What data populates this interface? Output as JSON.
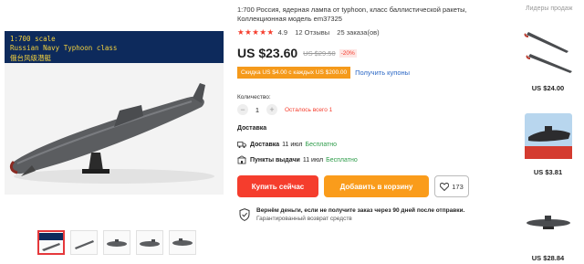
{
  "gallery": {
    "banner_lines": [
      "1:700 scale",
      "Russian Navy Typhoon class",
      "俄台风级潜艇"
    ],
    "thumbnail_count": 5
  },
  "product": {
    "title": "1:700 Россия, ядерная лампа от typhoon, класс баллистической ракеты, Коллекционная модель em37325",
    "stars": "★★★★★",
    "rating": "4.9",
    "reviews": "12 Отзывы",
    "orders": "25 заказа(ов)",
    "price": "US $23.60",
    "old_price": "US $29.50",
    "discount": "-20%",
    "coupon": "Скидка US $4.00 с каждых US $200.00",
    "coupon_link": "Получить купоны"
  },
  "quantity": {
    "label": "Количество:",
    "minus": "−",
    "value": "1",
    "plus": "+",
    "stock": "Осталось всего 1"
  },
  "delivery": {
    "title": "Доставка",
    "rows": [
      {
        "label": "Доставка",
        "date": "11 июл",
        "price": "Бесплатно"
      },
      {
        "label": "Пункты выдачи",
        "date": "11 июл",
        "price": "Бесплатно"
      }
    ]
  },
  "actions": {
    "buy_now": "Купить сейчас",
    "add_to_cart": "Добавить в корзину",
    "wishlist_count": "173"
  },
  "guarantee": {
    "title": "Вернём деньги, если не получите заказ через 90 дней после отправки.",
    "subtitle": "Гарантированный возврат средств"
  },
  "recommendations": {
    "title": "Лидеры продаж",
    "items": [
      {
        "price": "US $24.00"
      },
      {
        "price": "US $3.81"
      },
      {
        "price": "US $28.84"
      }
    ]
  },
  "colors": {
    "accent_red": "#f53d2d",
    "accent_orange": "#fa9c1b",
    "banner_navy": "#0d2a5c",
    "link_blue": "#2a67c5",
    "free_green": "#2e9c4a"
  }
}
